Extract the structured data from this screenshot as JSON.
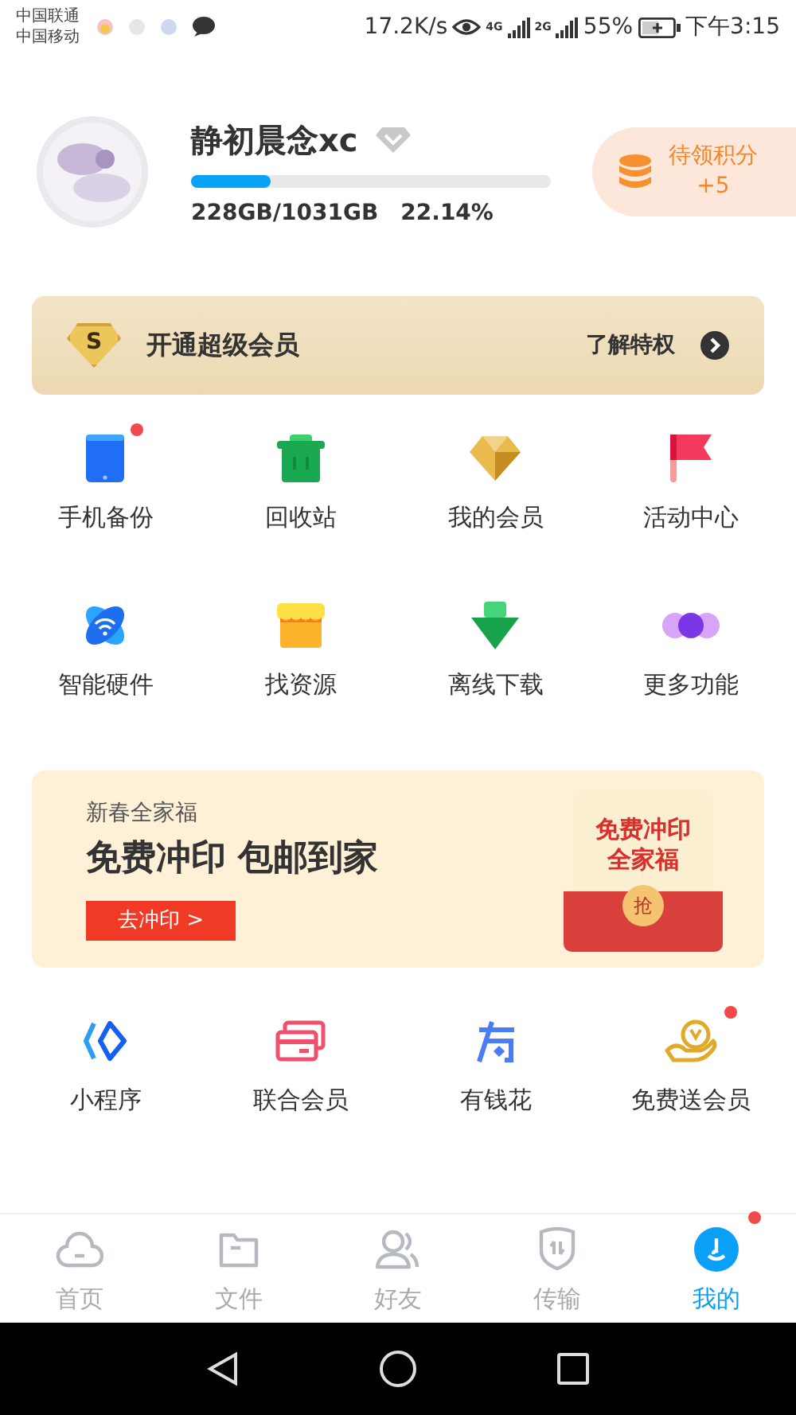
{
  "status_bar": {
    "carriers": [
      "中国联通",
      "中国移动"
    ],
    "speed": "17.2K/s",
    "network_1": "4G",
    "network_2": "2G",
    "battery": "55%",
    "time": "下午3:15"
  },
  "profile": {
    "name": "静初晨念xc",
    "storage": {
      "level": 0.2214,
      "used": "228GB/1031GB",
      "percent": "22.14%"
    },
    "points": {
      "label": "待领积分",
      "value": "+5"
    }
  },
  "vip_banner": {
    "badge": "S",
    "title": "开通超级会员",
    "link": "了解特权"
  },
  "shortcuts": [
    {
      "label": "手机备份",
      "kind": "phone",
      "badge": true
    },
    {
      "label": "回收站",
      "kind": "trash",
      "badge": false
    },
    {
      "label": "我的会员",
      "kind": "diamond",
      "badge": false
    },
    {
      "label": "活动中心",
      "kind": "flag",
      "badge": false
    },
    {
      "label": "智能硬件",
      "kind": "wifi",
      "badge": false
    },
    {
      "label": "找资源",
      "kind": "shop",
      "badge": false
    },
    {
      "label": "离线下载",
      "kind": "download",
      "badge": false
    },
    {
      "label": "更多功能",
      "kind": "more",
      "badge": false
    }
  ],
  "promo": {
    "subtitle": "新春全家福",
    "title": "免费冲印 包邮到家",
    "button": "去冲印 >",
    "envelope_lines": [
      "免费冲印",
      "全家福"
    ],
    "envelope_seal": "抢"
  },
  "services": [
    {
      "label": "小程序",
      "kind": "miniapp",
      "badge": false
    },
    {
      "label": "联合会员",
      "kind": "cards",
      "badge": false
    },
    {
      "label": "有钱花",
      "kind": "money",
      "badge": false
    },
    {
      "label": "免费送会员",
      "kind": "hand",
      "badge": true
    }
  ],
  "tabs": [
    {
      "label": "首页",
      "kind": "cloud",
      "selected": false,
      "badge": false
    },
    {
      "label": "文件",
      "kind": "folder",
      "selected": false,
      "badge": false
    },
    {
      "label": "好友",
      "kind": "friends",
      "selected": false,
      "badge": false
    },
    {
      "label": "传输",
      "kind": "transfer",
      "selected": false,
      "badge": false
    },
    {
      "label": "我的",
      "kind": "me",
      "selected": true,
      "badge": true
    }
  ]
}
